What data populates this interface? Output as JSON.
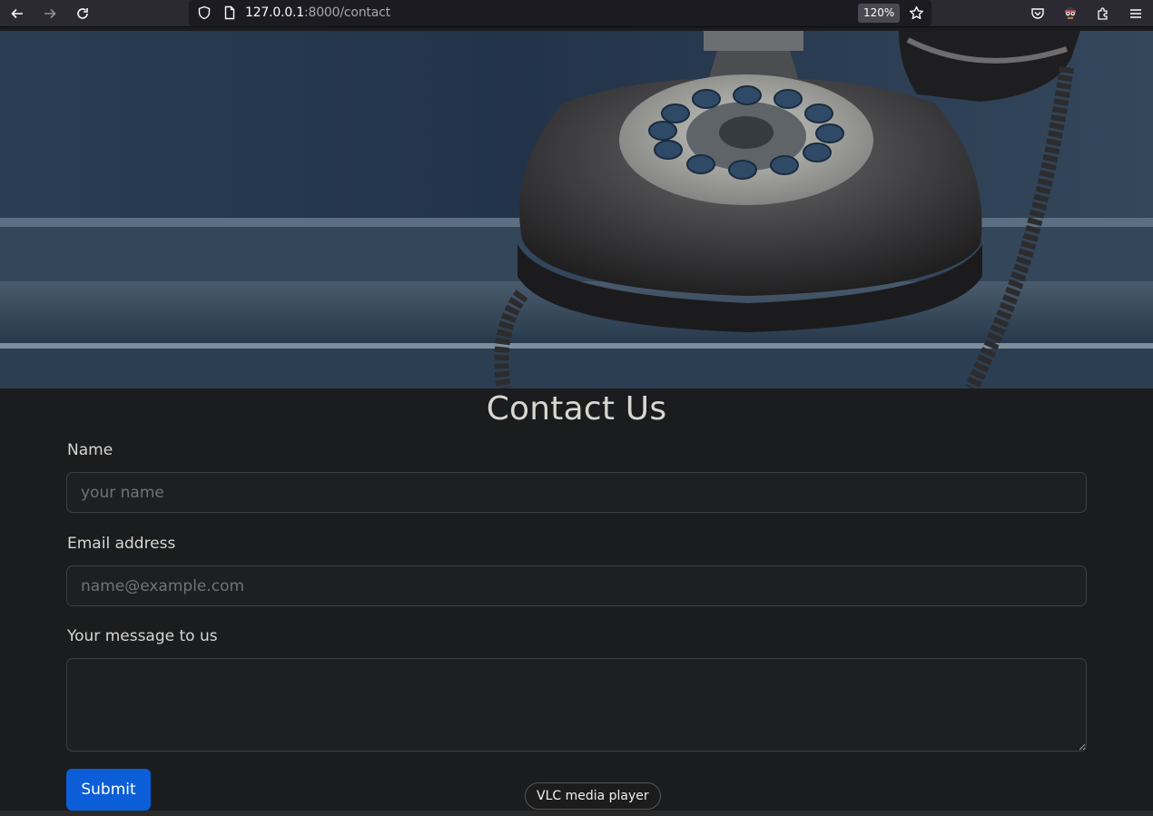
{
  "browser": {
    "url_host": "127.0.0.1",
    "url_rest": ":8000/contact",
    "zoom": "120%",
    "icons": [
      "back-arrow-icon",
      "forward-arrow-icon",
      "reload-icon",
      "shield-icon",
      "page-icon",
      "star-icon",
      "pocket-icon",
      "extension-mask-icon",
      "puzzle-icon",
      "hamburger-menu-icon"
    ]
  },
  "hero": {
    "image": "rotary-telephone-photo"
  },
  "page": {
    "title": "Contact Us",
    "name_label": "Name",
    "name_placeholder": "your name",
    "email_label": "Email address",
    "email_placeholder": "name@example.com",
    "message_label": "Your message to us",
    "submit_label": "Submit"
  },
  "overlay": {
    "tooltip": "VLC media player"
  },
  "colors": {
    "accent": "#0b5ed7",
    "background": "#1b1c1e",
    "toolbar": "#2b2a33"
  }
}
